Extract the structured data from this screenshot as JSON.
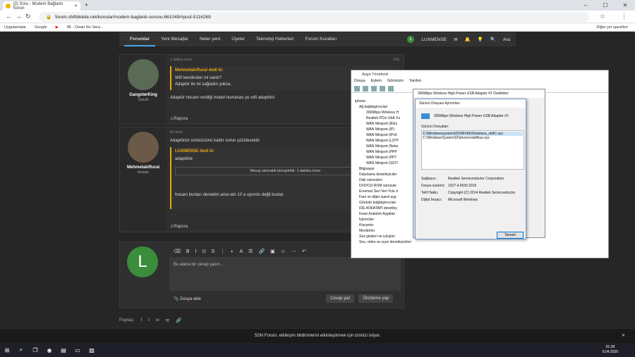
{
  "browser": {
    "tab_title": "(3) Soru - Modem Bağlantı Sorun",
    "url": "forum.shiftdelete.net/konular/modem-baglanti-sorunu.661049/#post-5116269",
    "bookmarks": [
      "Uygulamalar",
      "Google",
      "",
      "85 - Owari No Sera..."
    ],
    "other_bookmarks": "Diğer yer işaretleri"
  },
  "forum": {
    "nav": [
      "Forumlar",
      "Yeni Mesajlar",
      "Neler yeni",
      "Üyeler",
      "Teknoloji Haberleri",
      "Forum Kuralları"
    ],
    "user": "LUXMENSE",
    "search": "Ara"
  },
  "posts": [
    {
      "author": "GangsterKing",
      "title": "Üyecik",
      "time": "1 dakika önce",
      "num": "#16",
      "quote_head": "Mehmetakiftural dedi ki:",
      "quote_lines": [
        "Wifi kendinden mi vardı?",
        "Adaptör ile mi sağladın yoksa."
      ],
      "text": "Adaptör hocam verdiği model numarası pc wifi adaptörü",
      "report": "Rapora",
      "like": "Be"
    },
    {
      "author": "Mehmetakiftural",
      "title": "Asistan",
      "time": "Az önce",
      "text": "Adaptörün sürücüsünü kaldır sorun çözülecektir.",
      "quote_head": "LUXMENSE dedi ki:",
      "quote_lines": [
        "adaptörle"
      ],
      "merge": "Mesaj otomatik birleştirildi: 1 dakika önce",
      "quote_tail": "hocam bunları denedim ama win 10 a uyumlu değil bunlar",
      "report": "Rapora",
      "like": "Be"
    }
  ],
  "reply": {
    "avatar_letter": "L",
    "placeholder": "Bu alana bir cevap yazın...",
    "attach": "Dosya ekle",
    "reply_btn": "Cevap yaz",
    "preview_btn": "Önizleme yap"
  },
  "share_label": "Paylaş:",
  "cookie": "SDN Forum, etkileşim bildirimlerini etkinleştirmek için izninizi istiyor.",
  "devmgr": {
    "title": "Aygıt Yöneticisi",
    "menu": [
      "Dosya",
      "Eylem",
      "Görünüm",
      "Yardım"
    ],
    "tree": [
      "iphone",
      "Ağ bağdaştırıcıları",
      "300Mbps Wireless H",
      "Realtek PCIe GbE Fa",
      "WAN Miniport (IKEv",
      "WAN Miniport (IP)",
      "WAN Miniport (IPv6",
      "WAN Miniport (L2TP",
      "WAN Miniport (Netw",
      "WAN Miniport (PPP",
      "WAN Miniport (PPT",
      "WAN Miniport (SSTI",
      "Bilgisayar",
      "Depolama denetleyiciler",
      "Disk sürücüleri",
      "DVD/CD-ROM sürücüle",
      "Evrensel Seri Veri Yolu d",
      "Fare ve diğer işaret ayg",
      "Görüntü bağdaştırıcıları",
      "IDE ATA/ATAPI denetley",
      "İnsan Arabirim Aygıtları",
      "İşlemciler",
      "Klavyeler",
      "Monitörler",
      "Ses girişleri ve çıkışları",
      "Ses, video ve oyun denetleyicileri"
    ]
  },
  "props": {
    "title": "300Mbps Wireless High Power USB Adapter #2 Özellikleri"
  },
  "driver": {
    "title": "Sürücü Dosyası Ayrıntıları",
    "device": "300Mbps Wireless High Power USB Adapter #2",
    "files_label": "Sürücü Dosyaları:",
    "files": [
      "C:\\Windows\\system32\\DRIVERS\\rtwlanu_oldIC.sys",
      "C:\\Windows\\System32\\drivers\\vwifibus.sys"
    ],
    "rows": [
      [
        "Sağlayıcı:",
        "Realtek Semiconductor Corporation"
      ],
      [
        "Dosya sürümü:",
        "1027.4.0630.2015"
      ],
      [
        "Telif Hakkı:",
        "Copyright (C) 2014 Realtek Semiconductor"
      ],
      [
        "Dijital İmzacı:",
        "Microsoft Windows"
      ]
    ],
    "ok": "Tamam"
  },
  "clock": {
    "time": "01:28",
    "date": "9.04.2020"
  }
}
